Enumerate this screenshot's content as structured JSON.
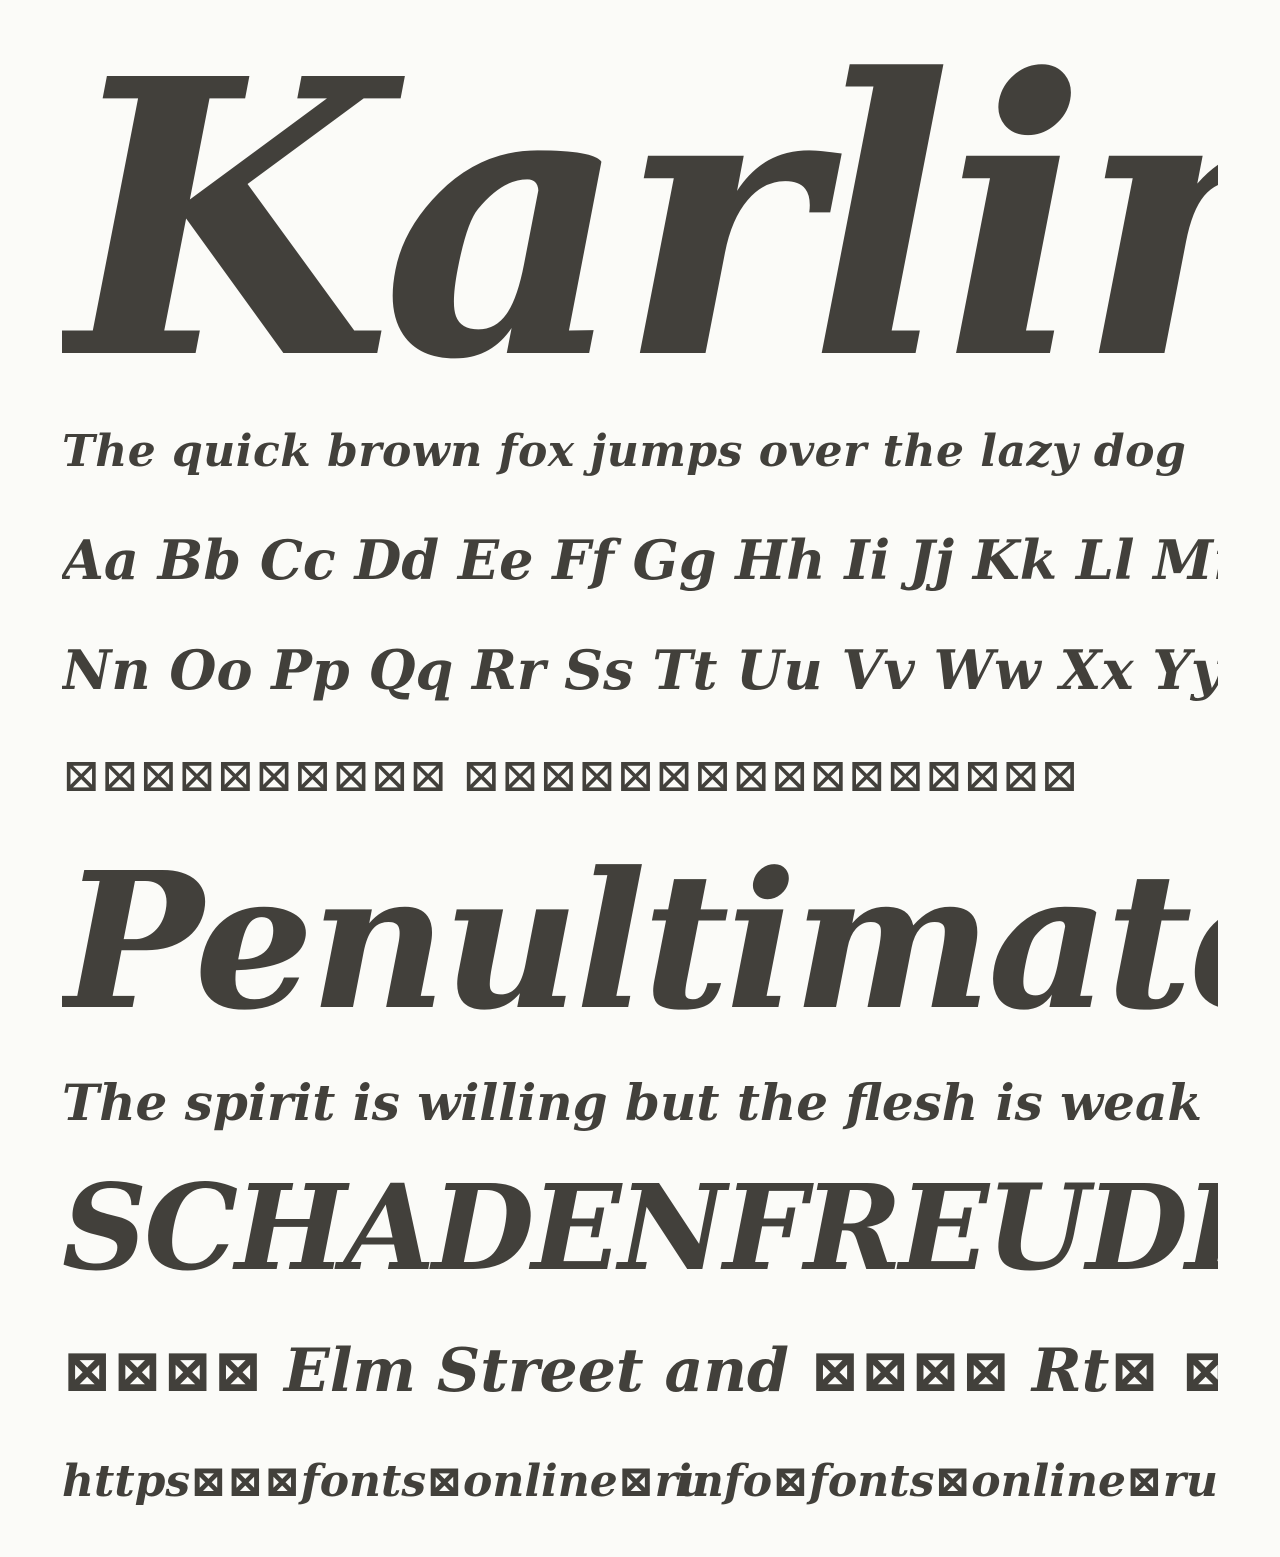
{
  "specimen": {
    "title": "Karlin",
    "pangram": "The quick brown fox jumps over the lazy dog",
    "alphabet_row_1": "Aa Bb Cc Dd Ee Ff Gg Hh Ii Jj Kk Ll Mm",
    "alphabet_row_2": "Nn Oo Pp Qq Rr Ss Tt Uu Vv Ww Xx Yy Zz",
    "unsupported_glyph_row": "⊠⊠⊠⊠⊠⊠⊠⊠⊠⊠ ⊠⊠⊠⊠⊠⊠⊠⊠⊠⊠⊠⊠⊠⊠⊠⊠",
    "sample_word": "Penultimate",
    "proverb": "The spirit is willing but the flesh is weak",
    "caps_word": "SCHADENFREUDE",
    "address_line": "⊠⊠⊠⊠ Elm Street and ⊠⊠⊠⊠ Rt⊠ ⊠⊠",
    "footer_left": "https⊠⊠⊠fonts⊠online⊠ru",
    "footer_right": "info⊠fonts⊠online⊠ru"
  },
  "colors": {
    "background": "#fbfbf8",
    "text": "#42403b"
  }
}
